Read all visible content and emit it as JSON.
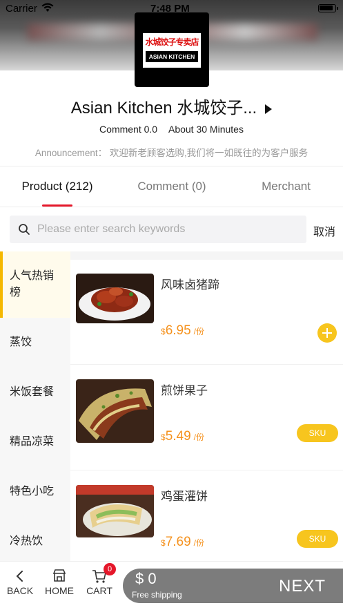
{
  "status_bar": {
    "carrier": "Carrier",
    "time": "7:48 PM"
  },
  "store": {
    "logo_text_cn": "水城饺子专卖店",
    "logo_text_en": "ASIAN KITCHEN",
    "name": "Asian Kitchen 水城饺子...",
    "comment": "Comment 0.0",
    "delivery_time": "About 30 Minutes",
    "announcement": "Announcement： 欢迎新老顾客选购,我们将一如既往的为客户服务"
  },
  "tabs": [
    {
      "label": "Product (212)",
      "active": true
    },
    {
      "label": "Comment (0)",
      "active": false
    },
    {
      "label": "Merchant",
      "active": false
    }
  ],
  "search": {
    "placeholder": "Please enter search keywords",
    "value": "",
    "cancel_label": "取消"
  },
  "categories": [
    {
      "label": "人气热销榜",
      "active": true
    },
    {
      "label": "蒸饺",
      "active": false
    },
    {
      "label": "米饭套餐",
      "active": false
    },
    {
      "label": "精品凉菜",
      "active": false
    },
    {
      "label": "特色小吃",
      "active": false
    },
    {
      "label": "冷热饮",
      "active": false
    }
  ],
  "products": [
    {
      "name": "风味卤猪蹄",
      "currency": "$",
      "price": "6.95",
      "unit": "/份",
      "action": "add",
      "action_label": ""
    },
    {
      "name": "煎饼果子",
      "currency": "$",
      "price": "5.49",
      "unit": "/份",
      "action": "sku",
      "action_label": "SKU"
    },
    {
      "name": "鸡蛋灌饼",
      "currency": "$",
      "price": "7.69",
      "unit": "/份",
      "action": "sku",
      "action_label": "SKU"
    }
  ],
  "bottom_bar": {
    "back_label": "BACK",
    "home_label": "HOME",
    "cart_label": "CART",
    "cart_count": "0",
    "total": "$ 0",
    "shipping": "Free shipping",
    "next_label": "NEXT"
  },
  "colors": {
    "accent_red": "#e5172a",
    "accent_yellow": "#f7c51e",
    "price_orange": "#f5921e",
    "checkout_gray": "#7c7c7c"
  }
}
